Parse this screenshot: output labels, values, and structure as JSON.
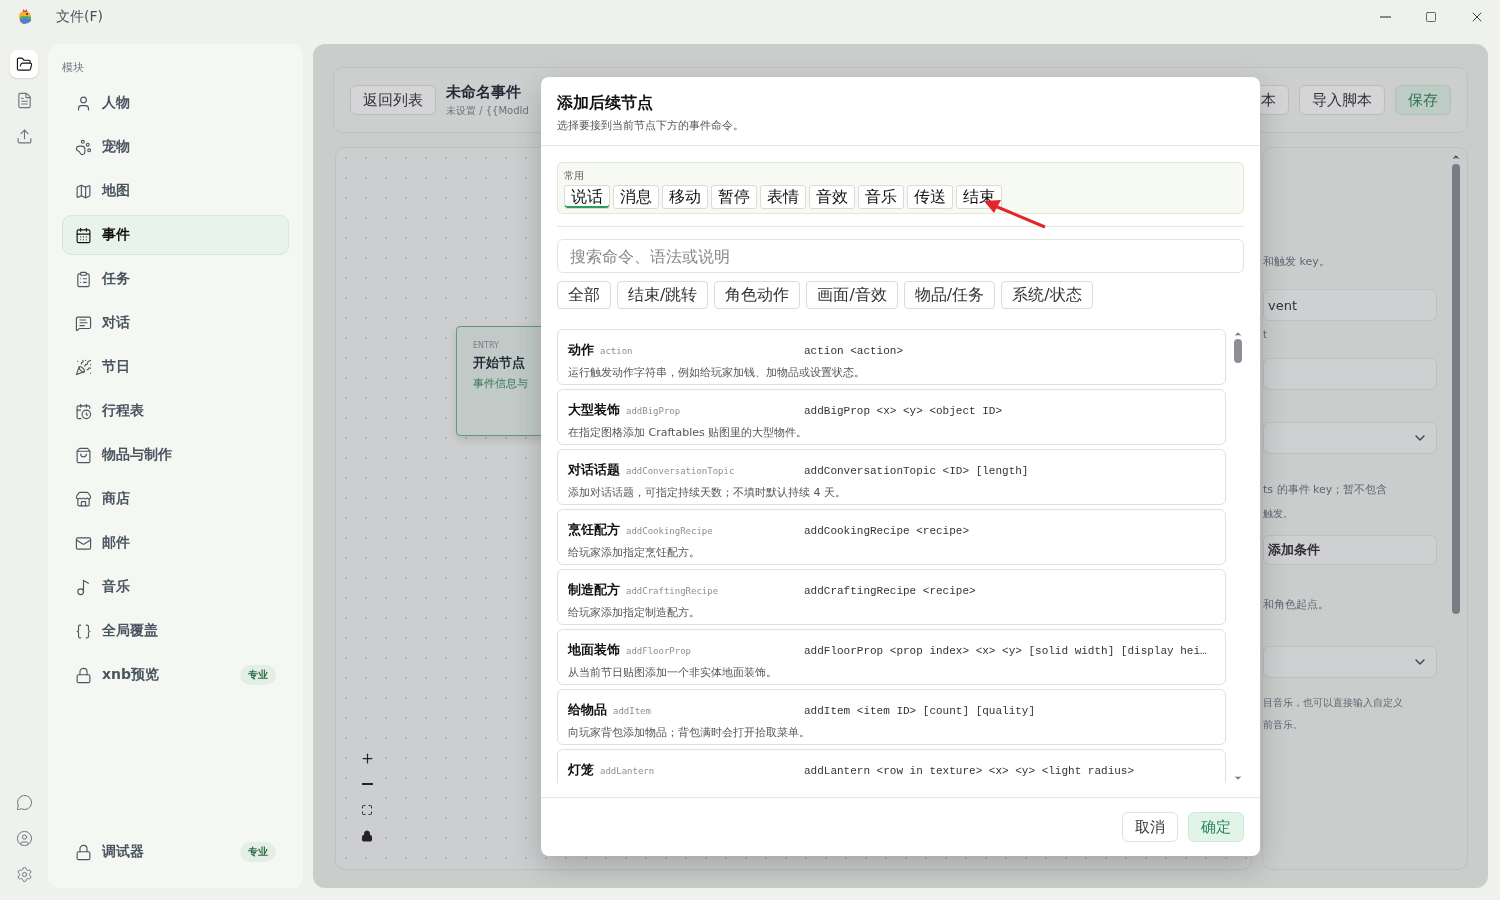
{
  "titlebar": {
    "menu": "文件(F)"
  },
  "rail": [
    {
      "selected": true
    },
    {
      "selected": false
    },
    {
      "selected": false
    }
  ],
  "sidebar": {
    "section": "模块",
    "items": [
      {
        "label": "人物",
        "selected": false
      },
      {
        "label": "宠物",
        "selected": false
      },
      {
        "label": "地图",
        "selected": false
      },
      {
        "label": "事件",
        "selected": true
      },
      {
        "label": "任务",
        "selected": false
      },
      {
        "label": "对话",
        "selected": false
      },
      {
        "label": "节日",
        "selected": false
      },
      {
        "label": "行程表",
        "selected": false
      },
      {
        "label": "物品与制作",
        "selected": false
      },
      {
        "label": "商店",
        "selected": false
      },
      {
        "label": "邮件",
        "selected": false
      },
      {
        "label": "音乐",
        "selected": false
      },
      {
        "label": "全局覆盖",
        "selected": false
      },
      {
        "label": "xnb预览",
        "selected": false,
        "badge": "专业"
      }
    ],
    "footer": {
      "label": "调试器",
      "badge": "专业"
    }
  },
  "editor": {
    "back_button": "返回列表",
    "title": "未命名事件",
    "subtitle": "未设置 / {{ModId",
    "buttons": [
      {
        "label": "本",
        "kind": "default"
      },
      {
        "label": "导入脚本",
        "kind": "default"
      },
      {
        "label": "保存",
        "kind": "primary"
      }
    ],
    "node": {
      "tag": "ENTRY",
      "title": "开始节点",
      "subtitle": "事件信息与"
    },
    "side": [
      {
        "kind": "text",
        "text": "和触发 key。"
      },
      {
        "kind": "field",
        "text": "vent"
      },
      {
        "kind": "hint",
        "text": "t"
      },
      {
        "kind": "field"
      },
      {
        "kind": "select"
      },
      {
        "kind": "text",
        "text": "ts 的事件 key；暂不包含"
      },
      {
        "kind": "hint",
        "text": "触发。"
      },
      {
        "kind": "button",
        "text": "添加条件"
      },
      {
        "kind": "text",
        "text": "和角色起点。"
      },
      {
        "kind": "select"
      },
      {
        "kind": "hint",
        "text": "目音乐，也可以直接输入自定义"
      },
      {
        "kind": "hint",
        "text": "前音乐。"
      }
    ]
  },
  "dialog": {
    "title": "添加后续节点",
    "subtitle": "选择要接到当前节点下方的事件命令。",
    "common": {
      "label": "常用",
      "chips": [
        {
          "label": "说话",
          "selected": true
        },
        {
          "label": "消息",
          "selected": false
        },
        {
          "label": "移动",
          "selected": false
        },
        {
          "label": "暂停",
          "selected": false
        },
        {
          "label": "表情",
          "selected": false
        },
        {
          "label": "音效",
          "selected": false
        },
        {
          "label": "音乐",
          "selected": false
        },
        {
          "label": "传送",
          "selected": false
        },
        {
          "label": "结束",
          "selected": false
        }
      ]
    },
    "search": {
      "placeholder": "搜索命令、语法或说明"
    },
    "filters": [
      {
        "label": "全部",
        "selected": false
      },
      {
        "label": "结束/跳转",
        "selected": false
      },
      {
        "label": "角色动作",
        "selected": false
      },
      {
        "label": "画面/音效",
        "selected": false
      },
      {
        "label": "物品/任务",
        "selected": false
      },
      {
        "label": "系统/状态",
        "selected": false
      }
    ],
    "commands": [
      {
        "name": "动作",
        "key": "action",
        "syntax": "action <action>",
        "description": "运行触发动作字符串，例如给玩家加钱、加物品或设置状态。"
      },
      {
        "name": "大型装饰",
        "key": "addBigProp",
        "syntax": "addBigProp <x> <y> <object ID>",
        "description": "在指定图格添加 Craftables 贴图里的大型物件。"
      },
      {
        "name": "对话话题",
        "key": "addConversationTopic",
        "syntax": "addConversationTopic <ID> [length]",
        "description": "添加对话话题，可指定持续天数；不填时默认持续 4 天。"
      },
      {
        "name": "烹饪配方",
        "key": "addCookingRecipe",
        "syntax": "addCookingRecipe <recipe>",
        "description": "给玩家添加指定烹饪配方。"
      },
      {
        "name": "制造配方",
        "key": "addCraftingRecipe",
        "syntax": "addCraftingRecipe <recipe>",
        "description": "给玩家添加指定制造配方。"
      },
      {
        "name": "地面装饰",
        "key": "addFloorProp",
        "syntax": "addFloorProp <prop index> <x> <y> [solid width] [display hei…",
        "description": "从当前节日贴图添加一个非实体地面装饰。"
      },
      {
        "name": "给物品",
        "key": "addItem",
        "syntax": "addItem <item ID> [count] [quality]",
        "description": "向玩家背包添加物品；背包满时会打开拾取菜单。"
      },
      {
        "name": "灯笼",
        "key": "addLantern",
        "syntax": "addLantern <row in texture> <x> <y> <light radius>"
      }
    ],
    "buttons": [
      {
        "label": "取消",
        "kind": "default"
      },
      {
        "label": "确定",
        "kind": "primary"
      }
    ]
  }
}
